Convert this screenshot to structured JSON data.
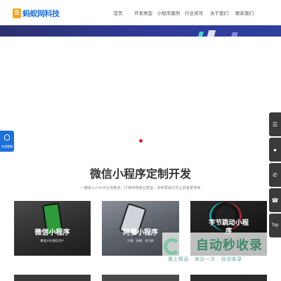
{
  "brand": {
    "logo_mark": "S",
    "name": "蚂蚁网科技"
  },
  "nav": [
    {
      "label": "首页"
    },
    {
      "label": "开发类型"
    },
    {
      "label": "小程序案例"
    },
    {
      "label": "行业资讯"
    },
    {
      "label": "关于我们"
    },
    {
      "label": "联系我们"
    }
  ],
  "left_service": {
    "label": "在线客服",
    "icon": "headset-icon"
  },
  "right_tools": [
    {
      "icon": "chat-icon",
      "label": "在线客服"
    },
    {
      "icon": "qq-icon",
      "label": ""
    },
    {
      "icon": "phone-icon",
      "label": ""
    },
    {
      "icon": "wechat-icon",
      "label": ""
    },
    {
      "icon": "back-to-top-icon",
      "label": "Top"
    }
  ],
  "section": {
    "title": "微信小程序定制开发",
    "subtitle": "一键接入六大平台流量池，打通传统商业壁垒，多种营销方式让获客更简单"
  },
  "cards": [
    {
      "title": "微信小程序",
      "desc": "覆盖10亿微信用户"
    },
    {
      "title": "阿里小程序",
      "desc": "方便、快捷、多功能"
    },
    {
      "title": "字节跳动小程序",
      "desc": ""
    }
  ],
  "watermark": {
    "title": "自动秒收录",
    "subtitle": "做上精品 · 来访一次 · 自动收录"
  },
  "colors": {
    "accent": "#1e6fd9",
    "banner": "#30399a",
    "slider_dot": "#e21f26"
  }
}
